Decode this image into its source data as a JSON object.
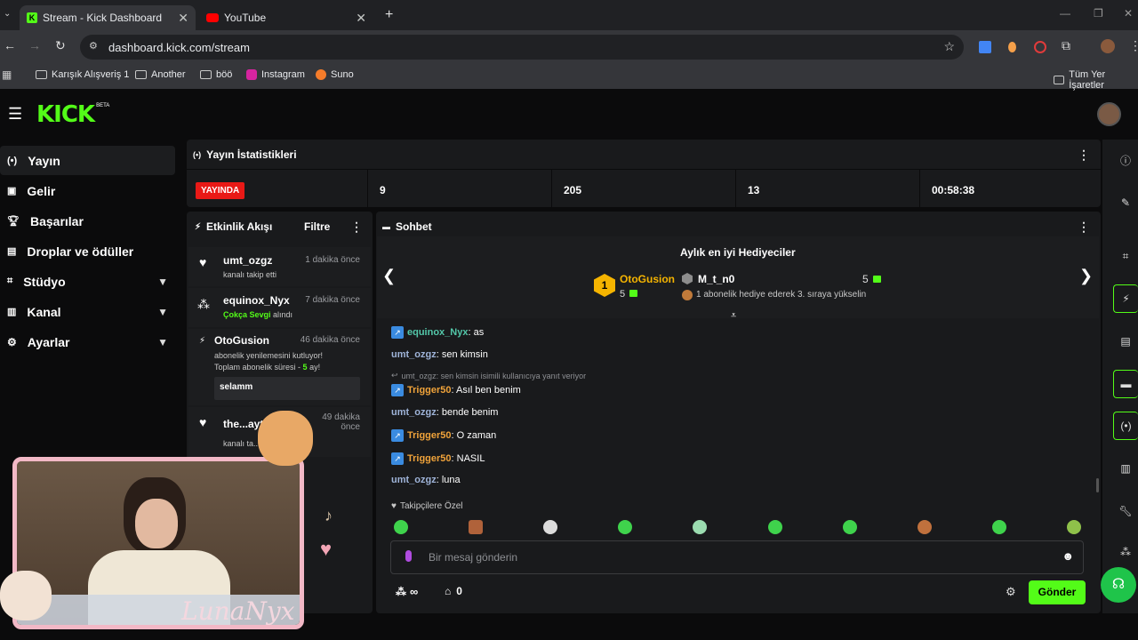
{
  "browser": {
    "tabs": [
      {
        "title": "Stream - Kick Dashboard"
      },
      {
        "title": "YouTube"
      }
    ],
    "url": "dashboard.kick.com/stream",
    "bookmarks": [
      "Karışık Alışveriş 1",
      "Another",
      "böö",
      "Instagram",
      "Suno"
    ],
    "bookmarks_right": "Tüm Yer İşaretler"
  },
  "kick": {
    "logo": "KICK",
    "logo_tag": "BETA",
    "sidebar": [
      {
        "label": "Yayın",
        "icon": "broadcast-icon"
      },
      {
        "label": "Gelir",
        "icon": "chart-icon"
      },
      {
        "label": "Başarılar",
        "icon": "trophy-icon"
      },
      {
        "label": "Droplar ve ödüller",
        "icon": "gift-icon"
      },
      {
        "label": "Stüdyo",
        "icon": "studio-icon"
      },
      {
        "label": "Kanal",
        "icon": "channel-icon"
      },
      {
        "label": "Ayarlar",
        "icon": "gear-icon"
      }
    ],
    "stats": {
      "title": "Yayın İstatistikleri",
      "live_badge": "YAYINDA",
      "values": [
        "9",
        "205",
        "13",
        "00:58:38"
      ]
    },
    "activity": {
      "title": "Etkinlik Akışı",
      "filter": "Filtre",
      "items": [
        {
          "name": "umt_ozgz",
          "time": "1 dakika önce",
          "sub": "kanalı takip etti"
        },
        {
          "name": "equinox_Nyx",
          "time": "7 dakika önce",
          "sub_highlight": "Çokça Sevgi",
          "sub_rest": " alındı"
        },
        {
          "name": "OtoGusion",
          "time": "46 dakika önce",
          "sub_a": "abonelik yenilemesini kutluyor!",
          "sub_b": "Toplam abonelik süresi - ",
          "sub_num": "5",
          "sub_c": " ay!",
          "message": "selamm"
        },
        {
          "name": "the...ayt",
          "time": "49 dakika önce",
          "sub": "kanalı ta..."
        }
      ]
    },
    "chat": {
      "title": "Sohbet",
      "gifters_title": "Aylık en iyi Hediyeciler",
      "top_gifter": {
        "rank": "1",
        "name": "OtoGusion",
        "count": "5"
      },
      "second_gifter": {
        "name": "M_t_n0",
        "count": "5",
        "hint": "1 abonelik hediye ederek 3. sıraya yükselin"
      },
      "messages": [
        {
          "user": "equinox_Nyx",
          "text": ": as",
          "color": "#53c7a9",
          "badge": true
        },
        {
          "user": "umt_ozgz",
          "text": ": sen kimsin",
          "color": "#9fb4d9",
          "badge": false
        },
        {
          "reply": "umt_ozgz: sen kimsin isimili kullanıcıya yanıt veriyor"
        },
        {
          "user": "Trigger50",
          "text": ": Asıl ben benim",
          "color": "#f0a33a",
          "badge": true
        },
        {
          "user": "umt_ozgz",
          "text": ": bende benim",
          "color": "#9fb4d9",
          "badge": false
        },
        {
          "user": "Trigger50",
          "text": ": O zaman",
          "color": "#f0a33a",
          "badge": true
        },
        {
          "user": "Trigger50",
          "text": ": NASIL",
          "color": "#f0a33a",
          "badge": true
        },
        {
          "user": "umt_ozgz",
          "text": ": luna",
          "color": "#9fb4d9",
          "badge": false
        }
      ],
      "followers_only": "Takipçilere Özel",
      "input_placeholder": "Bir mesaj gönderin",
      "points": "∞",
      "store_count": "0",
      "send": "Gönder"
    },
    "overlay_text": "LunaNyx",
    "colors": {
      "accent": "#53fc18",
      "live": "#e91916"
    }
  }
}
